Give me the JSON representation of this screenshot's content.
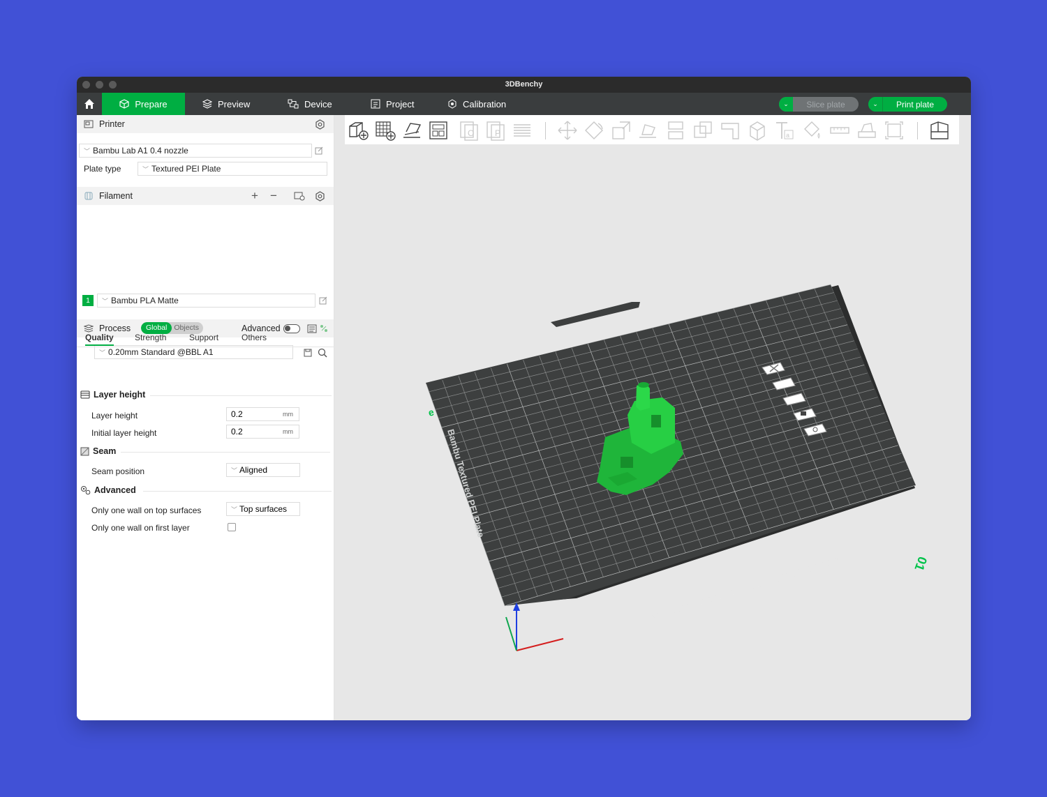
{
  "window": {
    "title": "3DBenchy"
  },
  "tabs": [
    {
      "label": "Prepare",
      "icon": "cube-icon",
      "active": true
    },
    {
      "label": "Preview",
      "icon": "layers-icon",
      "active": false
    },
    {
      "label": "Device",
      "icon": "device-icon",
      "active": false
    },
    {
      "label": "Project",
      "icon": "project-icon",
      "active": false
    },
    {
      "label": "Calibration",
      "icon": "calibration-icon",
      "active": false
    }
  ],
  "actions": {
    "slice_label": "Slice plate",
    "print_label": "Print plate"
  },
  "printer": {
    "section_label": "Printer",
    "selected": "Bambu Lab A1 0.4 nozzle",
    "plate_type_label": "Plate type",
    "plate_type": "Textured PEI Plate"
  },
  "filament": {
    "section_label": "Filament",
    "add_symbol": "+",
    "remove_symbol": "−",
    "slot": "1",
    "selected": "Bambu PLA Matte",
    "slot_color": "#00ae42"
  },
  "process": {
    "section_label": "Process",
    "scope_global": "Global",
    "scope_objects": "Objects",
    "advanced_label": "Advanced",
    "advanced_on": false,
    "preset": "0.20mm Standard @BBL A1",
    "subtabs": [
      "Quality",
      "Strength",
      "Support",
      "Others"
    ],
    "active_subtab": "Quality"
  },
  "quality": {
    "layer_height_group": "Layer height",
    "layer_height_label": "Layer height",
    "layer_height_value": "0.2",
    "initial_layer_height_label": "Initial layer height",
    "initial_layer_height_value": "0.2",
    "unit": "mm",
    "seam_group": "Seam",
    "seam_position_label": "Seam position",
    "seam_position_value": "Aligned",
    "advanced_group": "Advanced",
    "one_wall_top_label": "Only one wall on top surfaces",
    "one_wall_top_value": "Top surfaces",
    "one_wall_first_label": "Only one wall on first layer",
    "one_wall_first_checked": false
  },
  "plate": {
    "label": "Bambu Textured PEI Plate",
    "number": "01",
    "model_color": "#1fc43a"
  },
  "colors": {
    "accent": "#00ae42",
    "topbar": "#3a3d3e",
    "titlebar": "#2b2b2b",
    "background": "#4151d6"
  }
}
